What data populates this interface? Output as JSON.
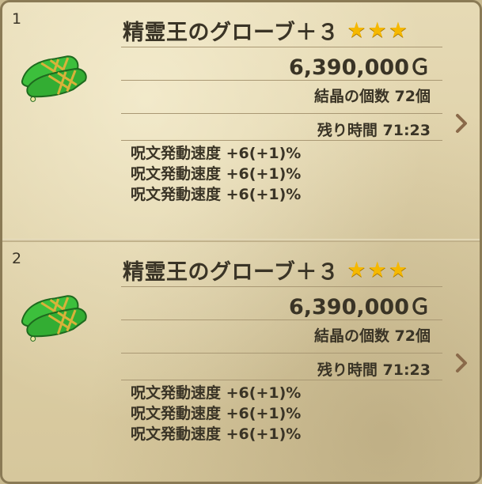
{
  "listings": [
    {
      "index": "1",
      "name": "精霊王のグローブ＋３",
      "stars": 3,
      "price": "6,390,000Ｇ",
      "crystals": "結晶の個数 72個",
      "time_left": "残り時間 71:23",
      "stats": [
        "呪文発動速度 +6(+1)%",
        "呪文発動速度 +6(+1)%",
        "呪文発動速度 +6(+1)%"
      ]
    },
    {
      "index": "2",
      "name": "精霊王のグローブ＋３",
      "stars": 3,
      "price": "6,390,000Ｇ",
      "crystals": "結晶の個数 72個",
      "time_left": "残り時間 71:23",
      "stats": [
        "呪文発動速度 +6(+1)%",
        "呪文発動速度 +6(+1)%",
        "呪文発動速度 +6(+1)%"
      ]
    }
  ],
  "colors": {
    "star": "#f5b800",
    "text": "#3a3426",
    "glove_green": "#3cbf3c",
    "glove_gold": "#d8b23a"
  }
}
